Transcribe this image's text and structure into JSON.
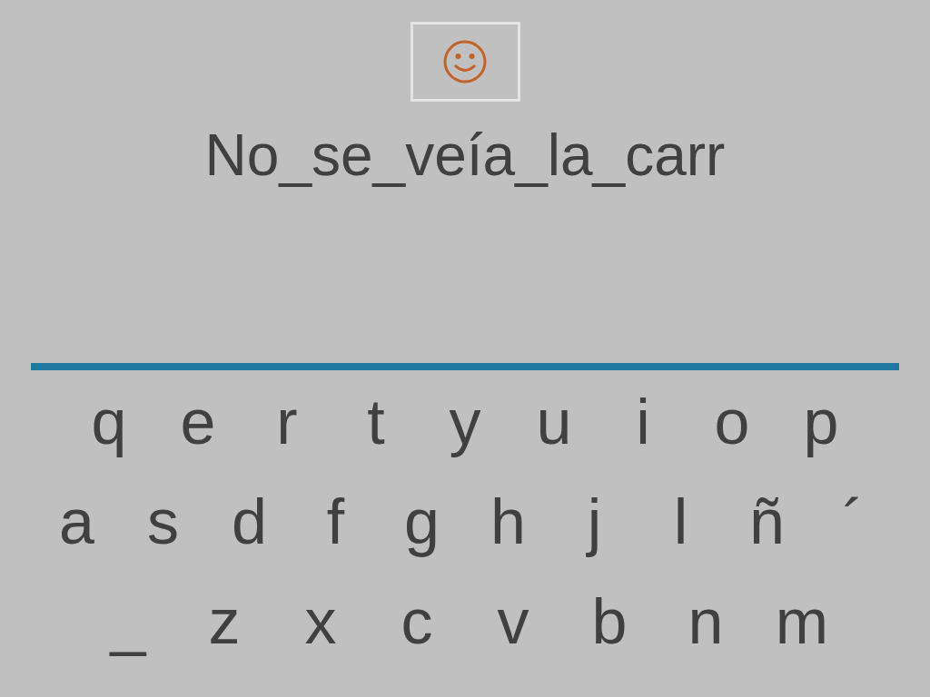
{
  "phrase": "No_se_veía_la_carr",
  "keyboard": {
    "rows": [
      {
        "keys": [
          "q",
          "e",
          "r",
          "t",
          "y",
          "u",
          "i",
          "o",
          "p"
        ]
      },
      {
        "keys": [
          "a",
          "s",
          "d",
          "f",
          "g",
          "h",
          "j",
          "l",
          "ñ",
          "´"
        ]
      },
      {
        "keys": [
          "_",
          "z",
          "x",
          "c",
          "v",
          "b",
          "n",
          "m"
        ]
      }
    ]
  }
}
